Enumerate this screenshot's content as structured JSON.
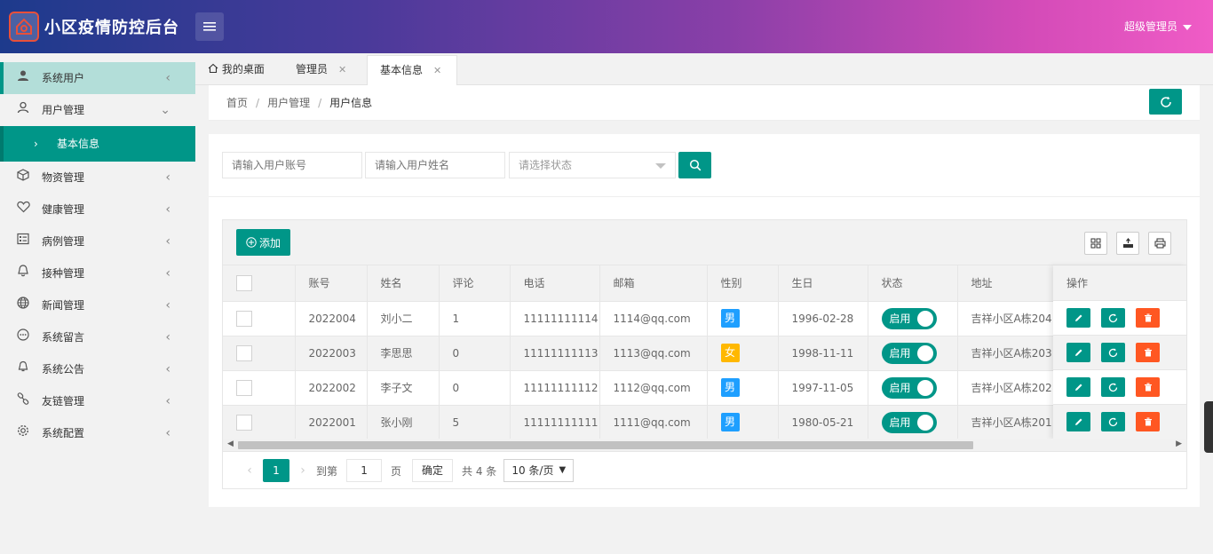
{
  "header": {
    "app_title": "小区疫情防控后台",
    "user_name": "超级管理员"
  },
  "sidebar": {
    "items": [
      {
        "label": "系统用户",
        "icon": "user-icon"
      },
      {
        "label": "用户管理",
        "icon": "user-outline-icon"
      },
      {
        "label": "基本信息",
        "icon": "chevron-right-icon"
      },
      {
        "label": "物资管理",
        "icon": "box-icon"
      },
      {
        "label": "健康管理",
        "icon": "heart-icon"
      },
      {
        "label": "病例管理",
        "icon": "list-icon"
      },
      {
        "label": "接种管理",
        "icon": "bell-icon"
      },
      {
        "label": "新闻管理",
        "icon": "globe-icon"
      },
      {
        "label": "系统留言",
        "icon": "message-icon"
      },
      {
        "label": "系统公告",
        "icon": "notice-icon"
      },
      {
        "label": "友链管理",
        "icon": "link-icon"
      },
      {
        "label": "系统配置",
        "icon": "gear-icon"
      }
    ]
  },
  "tabs": [
    {
      "label": "我的桌面"
    },
    {
      "label": "管理员"
    },
    {
      "label": "基本信息"
    }
  ],
  "breadcrumb": {
    "home": "首页",
    "section": "用户管理",
    "current": "用户信息"
  },
  "filters": {
    "account_placeholder": "请输入用户账号",
    "name_placeholder": "请输入用户姓名",
    "status_placeholder": "请选择状态"
  },
  "toolbar": {
    "add_label": "添加"
  },
  "table": {
    "columns": [
      "账号",
      "姓名",
      "评论",
      "电话",
      "邮箱",
      "性别",
      "生日",
      "状态",
      "地址",
      "操作"
    ],
    "rows": [
      {
        "account": "2022004",
        "name": "刘小二",
        "comments": "1",
        "phone": "11111111114",
        "email": "1114@qq.com",
        "sex": "男",
        "birthday": "1996-02-28",
        "status": "启用",
        "address": "吉祥小区A栋204"
      },
      {
        "account": "2022003",
        "name": "李思思",
        "comments": "0",
        "phone": "11111111113",
        "email": "1113@qq.com",
        "sex": "女",
        "birthday": "1998-11-11",
        "status": "启用",
        "address": "吉祥小区A栋203"
      },
      {
        "account": "2022002",
        "name": "李子文",
        "comments": "0",
        "phone": "11111111112",
        "email": "1112@qq.com",
        "sex": "男",
        "birthday": "1997-11-05",
        "status": "启用",
        "address": "吉祥小区A栋202"
      },
      {
        "account": "2022001",
        "name": "张小刚",
        "comments": "5",
        "phone": "11111111111",
        "email": "1111@qq.com",
        "sex": "男",
        "birthday": "1980-05-21",
        "status": "启用",
        "address": "吉祥小区A栋201"
      }
    ]
  },
  "pager": {
    "current_page": "1",
    "goto_label": "到第",
    "goto_value": "1",
    "page_unit": "页",
    "confirm_label": "确定",
    "total_label": "共 4 条",
    "page_size": "10 条/页"
  },
  "colors": {
    "accent": "#009688",
    "danger": "#ff5722",
    "male": "#1e9fff",
    "female": "#ffb800"
  }
}
